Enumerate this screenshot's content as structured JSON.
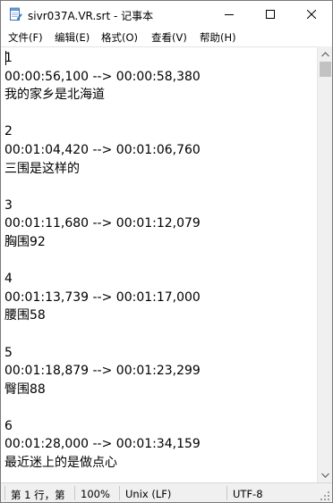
{
  "window": {
    "title": "sivr037A.VR.srt - 记事本"
  },
  "menu": {
    "file": "文件(F)",
    "edit": "编辑(E)",
    "format": "格式(O)",
    "view": "查看(V)",
    "help": "帮助(H)"
  },
  "document": {
    "lines": [
      "1",
      "00:00:56,100 --> 00:00:58,380",
      "我的家乡是北海道",
      "",
      "2",
      "00:01:04,420 --> 00:01:06,760",
      "三围是这样的",
      "",
      "3",
      "00:01:11,680 --> 00:01:12,079",
      "胸围92",
      "",
      "4",
      "00:01:13,739 --> 00:01:17,000",
      "腰围58",
      "",
      "5",
      "00:01:18,879 --> 00:01:23,299",
      "臀围88",
      "",
      "6",
      "00:01:28,000 --> 00:01:34,159",
      "最近迷上的是做点心"
    ]
  },
  "status": {
    "position": "第 1 行，第",
    "zoom": "100%",
    "line_ending": "Unix (LF)",
    "encoding": "UTF-8"
  },
  "icons": {
    "app": "notepad-icon",
    "minimize": "minimize-icon",
    "maximize": "maximize-icon",
    "close": "close-icon"
  }
}
